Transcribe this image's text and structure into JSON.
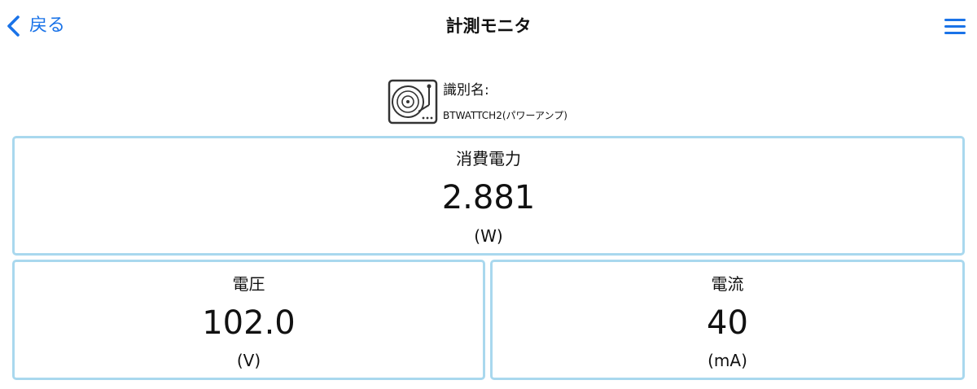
{
  "navbar": {
    "back_label": "戻る",
    "title": "計測モニタ",
    "back_icon": "chevron-left-icon",
    "menu_icon": "hamburger-menu-icon",
    "accent_color": "#1a73e8"
  },
  "device": {
    "icon": "turntable-icon",
    "label": "識別名:",
    "name": "BTWATTCH2(パワーアンプ)"
  },
  "metrics": {
    "power": {
      "label": "消費電力",
      "value": "2.881",
      "unit": "(W)"
    },
    "voltage": {
      "label": "電圧",
      "value": "102.0",
      "unit": "(V)"
    },
    "current": {
      "label": "電流",
      "value": "40",
      "unit": "(mA)"
    },
    "border_color": "#a9d8ee"
  }
}
